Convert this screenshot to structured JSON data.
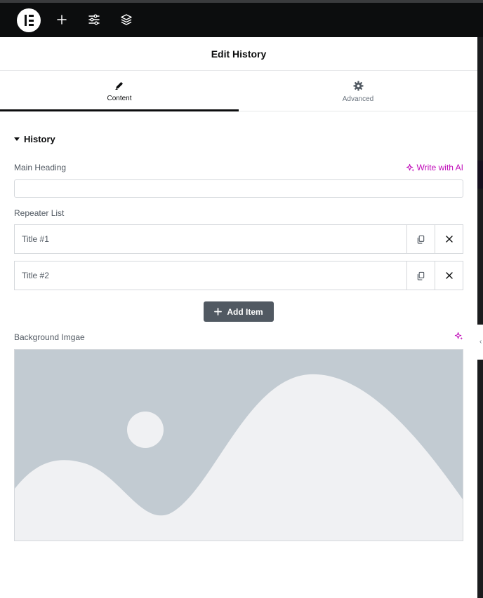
{
  "topbar": {
    "logo": "elementor-logo",
    "icons": [
      "plus-icon",
      "sliders-icon",
      "layers-icon"
    ]
  },
  "panel": {
    "title": "Edit History",
    "tabs": [
      {
        "label": "Content",
        "icon": "pencil-icon",
        "active": true
      },
      {
        "label": "Advanced",
        "icon": "gear-icon",
        "active": false
      }
    ],
    "section": {
      "title": "History",
      "expanded": true
    },
    "main_heading": {
      "label": "Main Heading",
      "value": "",
      "ai_label": "Write with AI"
    },
    "repeater": {
      "label": "Repeater List",
      "items": [
        {
          "title": "Title #1"
        },
        {
          "title": "Title #2"
        }
      ],
      "add_label": "Add Item"
    },
    "background_image": {
      "label": "Background Imgae",
      "placeholder": "image-placeholder"
    }
  },
  "colors": {
    "ai_accent": "#c00bb9",
    "topbar_bg": "#0c0d0e",
    "button_bg": "#515962",
    "placeholder_bg": "#c2cbd2",
    "placeholder_fg": "#f0f1f3"
  }
}
